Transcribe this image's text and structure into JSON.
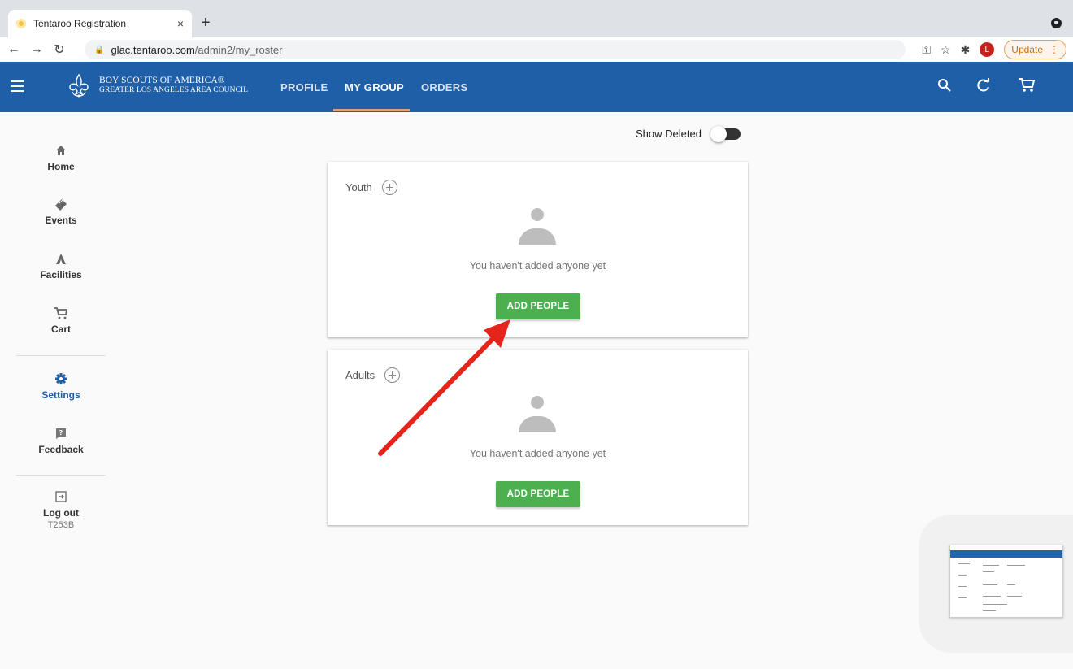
{
  "browser": {
    "tab_title": "Tentaroo Registration",
    "tab_close": "×",
    "new_tab": "+",
    "url_host": "glac.tentaroo.com",
    "url_path": "/admin2/my_roster",
    "update_label": "Update",
    "profile_initial": "L"
  },
  "header": {
    "org_line1": "BOY SCOUTS OF AMERICA®",
    "org_line2": "GREATER LOS ANGELES AREA COUNCIL",
    "tabs": [
      {
        "label": "PROFILE",
        "active": false
      },
      {
        "label": "MY GROUP",
        "active": true
      },
      {
        "label": "ORDERS",
        "active": false
      }
    ],
    "colors": {
      "bar": "#1f5fa8",
      "active_underline": "#e1a17a"
    }
  },
  "sidebar": {
    "items": [
      {
        "label": "Home",
        "icon": "home-icon"
      },
      {
        "label": "Events",
        "icon": "tickets-icon"
      },
      {
        "label": "Facilities",
        "icon": "tent-icon"
      },
      {
        "label": "Cart",
        "icon": "cart-icon"
      },
      {
        "label": "Settings",
        "icon": "gear-icon",
        "active": true
      },
      {
        "label": "Feedback",
        "icon": "feedback-icon"
      },
      {
        "label": "Log out",
        "icon": "logout-icon",
        "sub": "T253B"
      }
    ]
  },
  "main": {
    "show_deleted_label": "Show Deleted",
    "show_deleted_on": false,
    "sections": [
      {
        "title": "Youth",
        "empty_message": "You haven't added anyone yet",
        "button": "ADD PEOPLE"
      },
      {
        "title": "Adults",
        "empty_message": "You haven't added anyone yet",
        "button": "ADD PEOPLE"
      }
    ],
    "button_color": "#4caf50"
  }
}
